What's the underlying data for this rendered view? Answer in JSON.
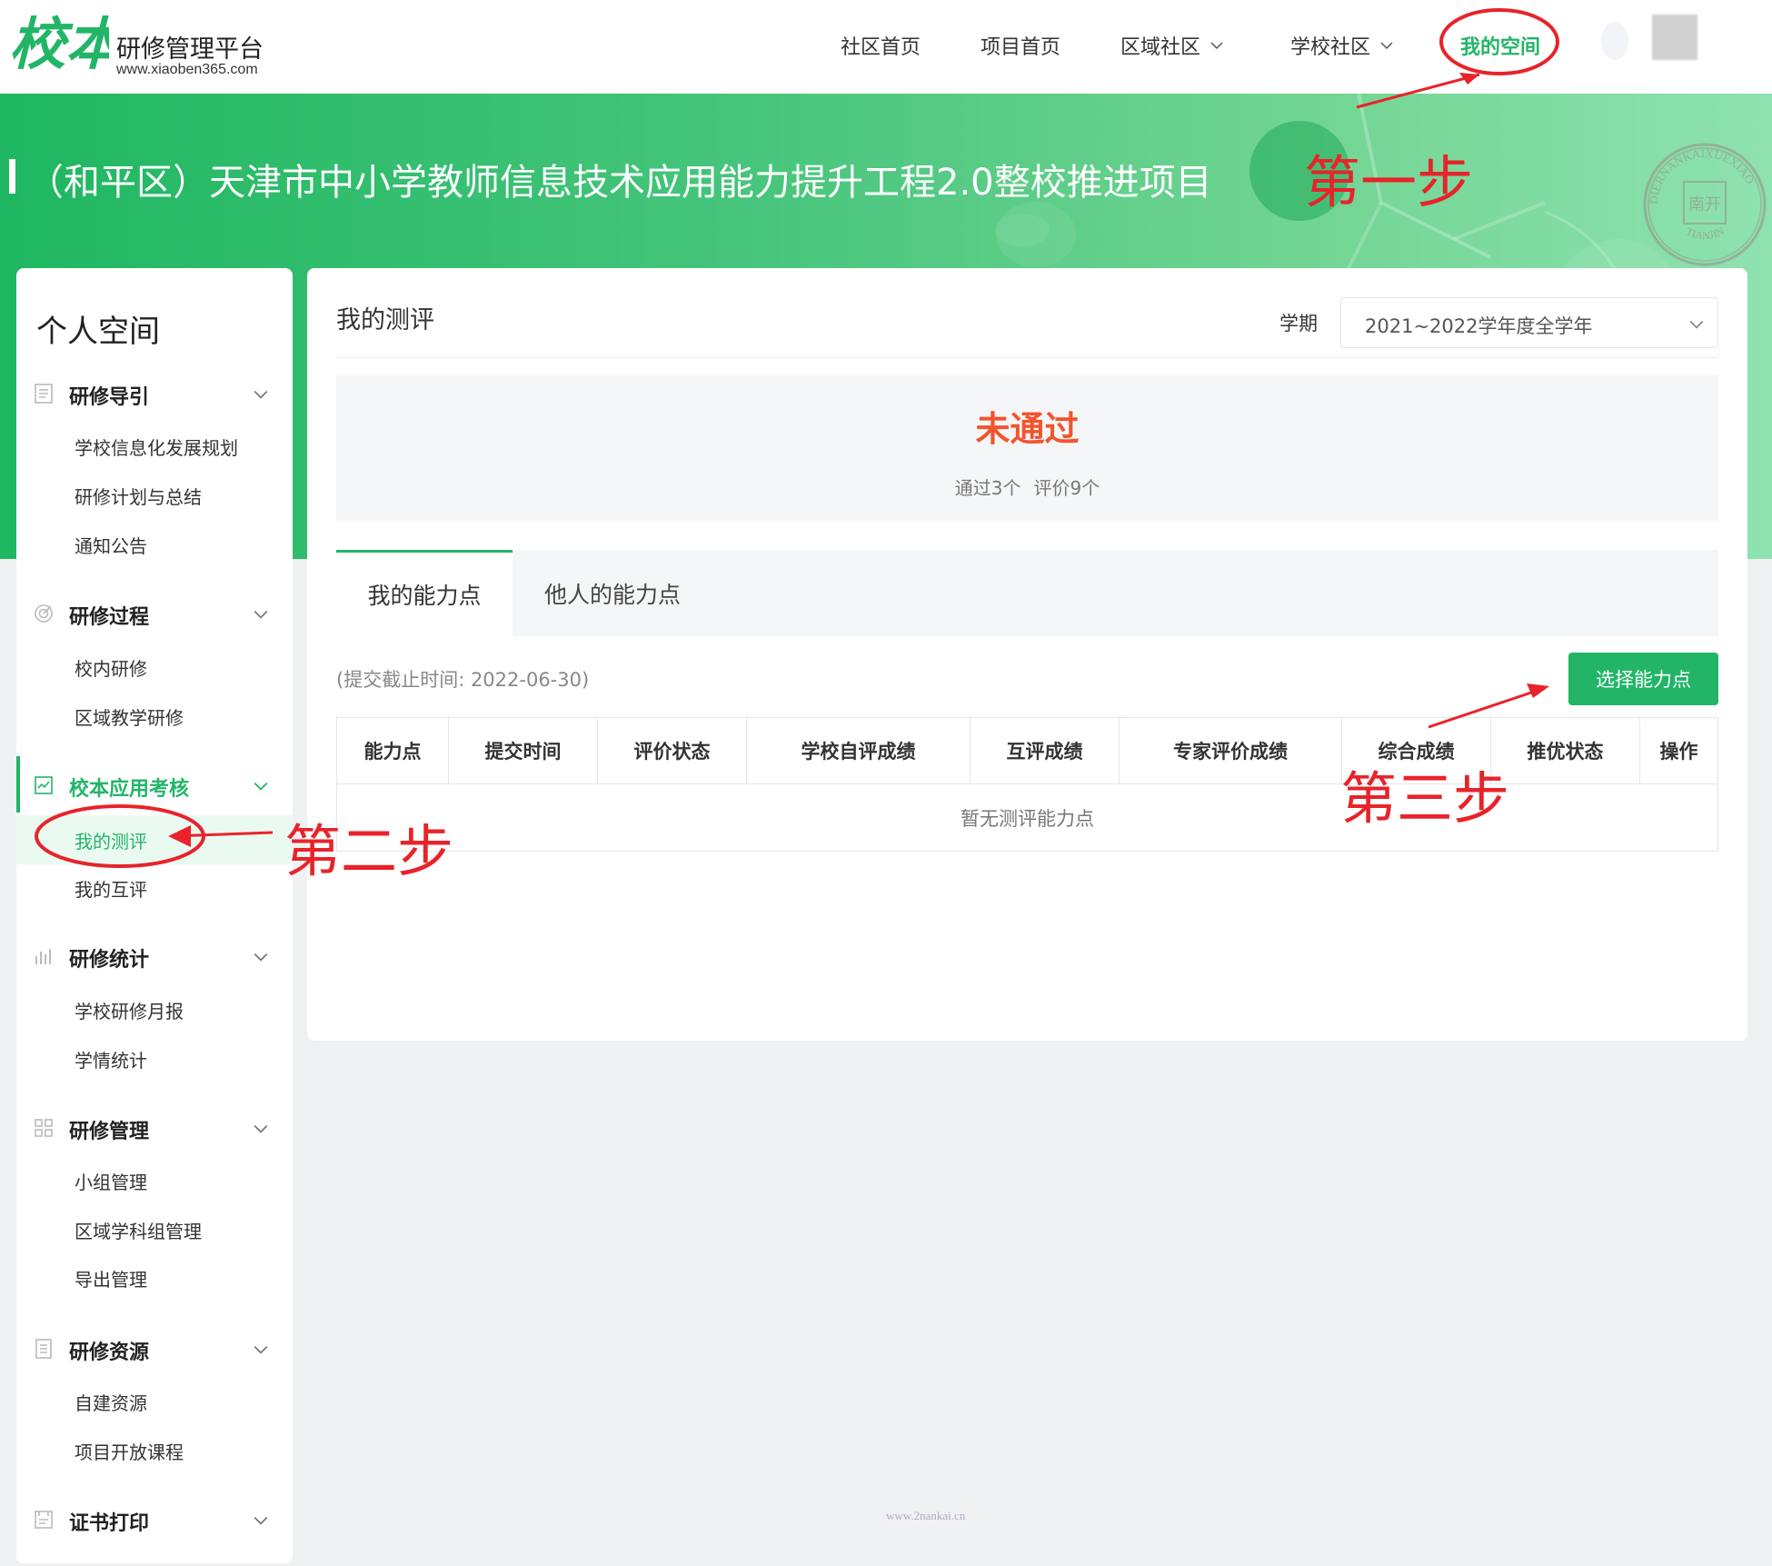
{
  "app": {
    "logo_mark": "校本",
    "logo_title": "研修管理平台",
    "logo_url": "www.xiaoben365.com"
  },
  "nav": {
    "items": [
      {
        "label": "社区首页",
        "has_dropdown": false,
        "active": false
      },
      {
        "label": "项目首页",
        "has_dropdown": false,
        "active": false
      },
      {
        "label": "区域社区",
        "has_dropdown": true,
        "active": false
      },
      {
        "label": "学校社区",
        "has_dropdown": true,
        "active": false
      },
      {
        "label": "我的空间",
        "has_dropdown": false,
        "active": true
      }
    ]
  },
  "banner": {
    "title": "（和平区）天津市中小学教师信息技术应用能力提升工程2.0整校推进项目"
  },
  "seal": {
    "text": "DIERNANKAIXUEXIAO",
    "bottom_text": "TIANJIN",
    "center": "南开"
  },
  "sidebar": {
    "title": "个人空间",
    "groups": [
      {
        "label": "研修导引",
        "icon": "document-list-icon",
        "items": [
          "学校信息化发展规划",
          "研修计划与总结",
          "通知公告"
        ]
      },
      {
        "label": "研修过程",
        "icon": "target-icon",
        "items": [
          "校内研修",
          "区域教学研修"
        ]
      },
      {
        "label": "校本应用考核",
        "icon": "chart-check-icon",
        "active": true,
        "items": [
          "我的测评",
          "我的互评"
        ],
        "selected": "我的测评"
      },
      {
        "label": "研修统计",
        "icon": "bar-chart-icon",
        "items": [
          "学校研修月报",
          "学情统计"
        ]
      },
      {
        "label": "研修管理",
        "icon": "grid-icon",
        "items": [
          "小组管理",
          "区域学科组管理",
          "导出管理"
        ]
      },
      {
        "label": "研修资源",
        "icon": "file-icon",
        "items": [
          "自建资源",
          "项目开放课程"
        ]
      },
      {
        "label": "证书打印",
        "icon": "certificate-icon",
        "items": []
      }
    ]
  },
  "main": {
    "title": "我的测评",
    "term_label": "学期",
    "term_value": "2021~2022学年度全学年",
    "result_status": "未通过",
    "passed": "通过3个",
    "evaluated": "评价9个",
    "tabs": [
      {
        "label": "我的能力点",
        "active": true
      },
      {
        "label": "他人的能力点",
        "active": false
      }
    ],
    "deadline": "(提交截止时间: 2022-06-30)",
    "select_button": "选择能力点",
    "table": {
      "columns": [
        "能力点",
        "提交时间",
        "评价状态",
        "学校自评成绩",
        "互评成绩",
        "专家评价成绩",
        "综合成绩",
        "推优状态",
        "操作"
      ],
      "empty_text": "暂无测评能力点"
    }
  },
  "annotations": {
    "step1": "第一步",
    "step2": "第二步",
    "step3": "第三步",
    "color": "#e8232a"
  },
  "watermark": "www.2nankai.cn",
  "colors": {
    "accent": "#22b568",
    "fail": "#f2542d"
  }
}
